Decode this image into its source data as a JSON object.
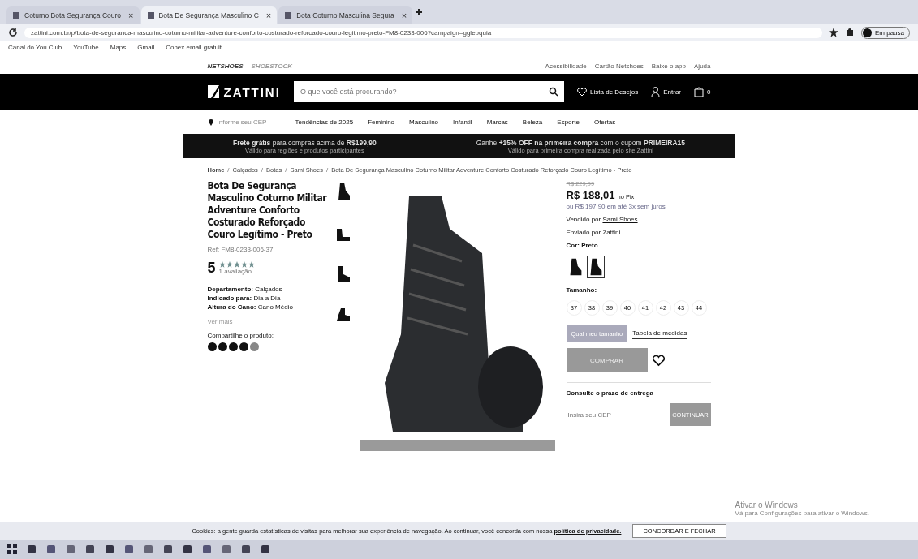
{
  "browser": {
    "tabs": [
      {
        "title": "Coturno Bota Segurança Couro",
        "close": "×",
        "selected": false
      },
      {
        "title": "Bota De Segurança Masculino C",
        "close": "×",
        "selected": true
      },
      {
        "title": "Bota Coturno Masculina Segura",
        "close": "×",
        "selected": false
      }
    ],
    "url": "zattini.com.br/p/bota-de-seguranca-masculino-coturno-militar-adventure-conforto-costurado-reforcado-couro-legitimo-preto-FM8-0233-006?campaign=gglepquia",
    "profile_label": "Em pausa",
    "bookmarks": [
      "Canal do You Club",
      "YouTube",
      "Maps",
      "Gmail",
      "Conex email gratuit"
    ]
  },
  "site": {
    "group_brands": [
      "NETSHOES",
      "SHOESTOCK"
    ],
    "top_links": [
      "Acessibilidade",
      "Cartão Netshoes",
      "Baixe o app",
      "Ajuda"
    ],
    "logo": "ZATTINI",
    "search": {
      "placeholder": "O que você está procurando?"
    },
    "wishlist": "Lista de Desejos",
    "login": "Entrar",
    "cart_count": "0",
    "location": "Informe seu CEP",
    "nav": [
      "Tendências de 2025",
      "Feminino",
      "Masculino",
      "Infantil",
      "Marcas",
      "Beleza",
      "Esporte",
      "Ofertas"
    ],
    "promos": [
      {
        "text": "**Frete grátis** para compras acima de **R$199,90**",
        "note": "Válido para regiões e produtos participantes"
      },
      {
        "text": "Ganhe **+15% OFF na primeira compra** com o cupom **PRIMEIRA15**",
        "note": "Válido para primeira compra realizada pelo site Zattini"
      }
    ]
  },
  "breadcrumb": [
    {
      "label": "Home"
    },
    {
      "separator": "/",
      "label": "Calçados"
    },
    {
      "separator": "/",
      "label": "Botas"
    },
    {
      "separator": "/",
      "label": "Sami Shoes"
    },
    {
      "separator": "/",
      "label": "Bota De Segurança Masculino Coturno Militar Adventure Conforto Costurado Reforçado Couro Legítimo - Preto"
    }
  ],
  "product": {
    "title": "Bota De Segurança Masculino Coturno Militar Adventure Conforto Costurado Reforçado Couro Legítimo - Preto",
    "ref": "Ref: FM8-0233-006-37",
    "rating": "5",
    "stars": 5,
    "reviews": "1 avaliação",
    "specs": [
      {
        "label": "Departamento:",
        "value": "Calçados"
      },
      {
        "label": "Indicado para:",
        "value": "Dia a Dia"
      },
      {
        "label": "Altura do Cano:",
        "value": "Cano Médio"
      }
    ],
    "see_more": "Ver mais",
    "share_label": "Compartilhe o produto:",
    "old_price": "R$ 229,99",
    "price": "R$ 188,01",
    "price_note": "no Pix",
    "installments": "ou R$ 197,90 em até 3x sem juros",
    "seller_label": "Vendido por",
    "seller": "Sami Shoes",
    "shipped_by": "Enviado por Zattini",
    "color_label": "Cor: Preto",
    "swatches": [
      {
        "selected": false
      },
      {
        "selected": true
      }
    ],
    "size_label": "Tamanho:",
    "sizes": [
      "37",
      "38",
      "39",
      "40",
      "41",
      "42",
      "43",
      "44"
    ],
    "size_help": "Qual meu tamanho",
    "size_table": "Tabela de medidas",
    "buy": "COMPRAR",
    "buy_disabled": true,
    "delivery_label": "Consulte o prazo de entrega",
    "cep": {
      "placeholder": "Insira seu CEP"
    },
    "continue": "CONTINUAR"
  },
  "windows_notice": {
    "title": "Ativar o Windows",
    "text": "Vá para Configurações para ativar o Windows."
  },
  "cookie": {
    "text": "Cookies: a gente guarda estatísticas de visitas para melhorar sua experiência de navegação. Ao continuar, você concorda com nossa",
    "link": "política de privacidade.",
    "button": "CONCORDAR E FECHAR"
  }
}
